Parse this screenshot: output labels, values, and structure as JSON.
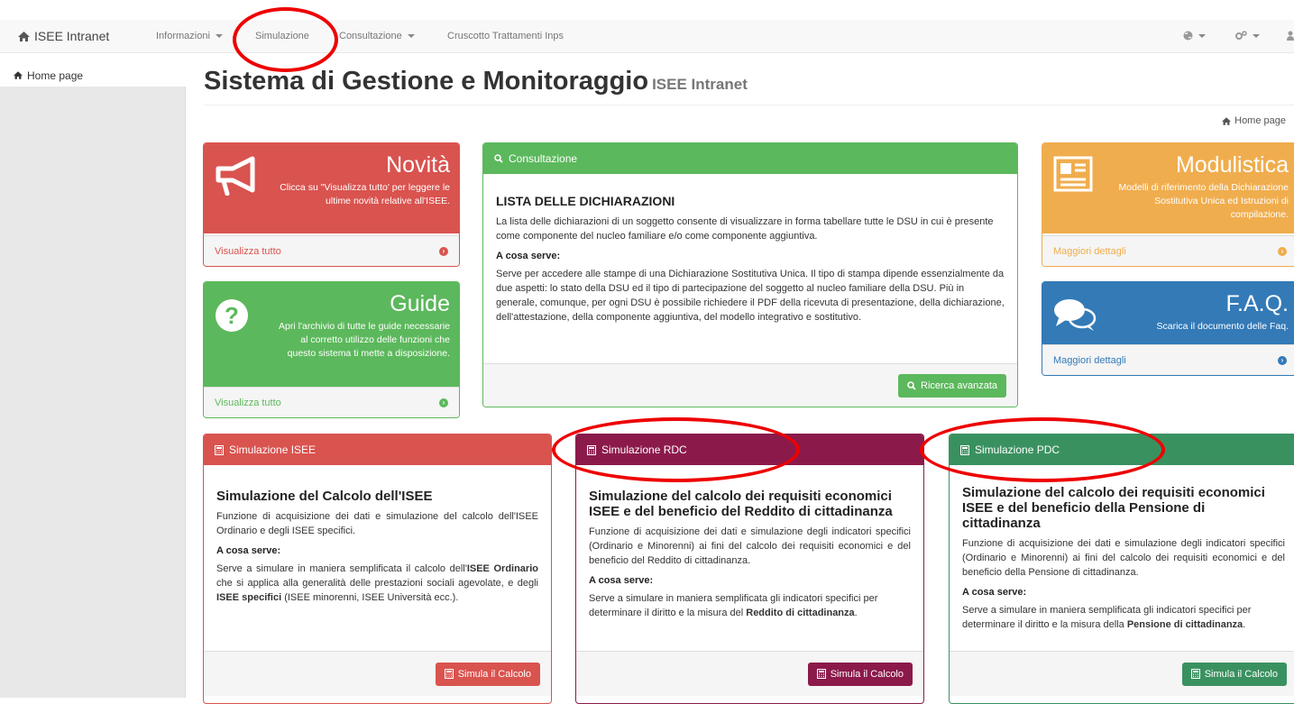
{
  "navbar": {
    "brand": "ISEE Intranet",
    "items": [
      {
        "label": "Informazioni",
        "has_caret": true
      },
      {
        "label": "Simulazione",
        "has_caret": false
      },
      {
        "label": "Consultazione",
        "has_caret": true
      },
      {
        "label": "Cruscotto Trattamenti Inps",
        "has_caret": false
      }
    ],
    "right_icons": [
      "globe-icon",
      "cogs-icon",
      "user-icon"
    ]
  },
  "sidebar": {
    "items": [
      {
        "label": "Home page",
        "icon": "home-icon"
      }
    ]
  },
  "header": {
    "title": "Sistema di Gestione e Monitoraggio",
    "subtitle": "ISEE Intranet"
  },
  "breadcrumb": {
    "label": "Home page"
  },
  "novita": {
    "title": "Novità",
    "description": "Clicca su \"Visualizza tutto' per leggere le ultime novità relative all'ISEE.",
    "footer": "Visualizza tutto",
    "color": "#d9534f"
  },
  "guide": {
    "title": "Guide",
    "description": "Apri l'archivio di tutte le guide necessarie al corretto utilizzo delle funzioni che questo sistema ti mette a disposizione.",
    "footer": "Visualizza tutto",
    "color": "#5cb85c"
  },
  "consultazione": {
    "heading": "Consultazione",
    "title": "LISTA DELLE DICHIARAZIONI",
    "intro": "La lista delle dichiarazioni di un soggetto consente di visualizzare in forma tabellare tutte le DSU in cui è presente come componente del nucleo familiare e/o come componente aggiuntiva.",
    "subtitle": "A cosa serve:",
    "body": "Serve per accedere alle stampe di una Dichiarazione Sostitutiva Unica. Il tipo di stampa dipende essenzialmente da due aspetti: lo stato della DSU ed il tipo di partecipazione del soggetto al nucleo familiare della DSU. Più in generale, comunque, per ogni DSU è possibile richiedere il PDF della ricevuta di presentazione, della dichiarazione, dell'attestazione, della componente aggiuntiva, del modello integrativo e sostitutivo.",
    "button": "Ricerca avanzata",
    "color": "#5cb85c"
  },
  "modulistica": {
    "title": "Modulistica",
    "description": "Modelli di riferimento della Dichiarazione Sostitutiva Unica ed Istruzioni di compilazione.",
    "footer": "Maggiori dettagli",
    "color": "#f0ad4e"
  },
  "faq": {
    "title": "F.A.Q.",
    "description": "Scarica il documento delle Faq.",
    "footer": "Maggiori dettagli",
    "color": "#337ab7"
  },
  "sim_isee": {
    "heading": "Simulazione ISEE",
    "title": "Simulazione del Calcolo dell'ISEE",
    "intro": "Funzione di acquisizione dei dati e simulazione del calcolo dell'ISEE Ordinario e degli ISEE specifici.",
    "subtitle": "A cosa serve:",
    "body_1": "Serve a simulare in maniera semplificata il calcolo dell'",
    "body_b1": "ISEE Ordinario",
    "body_2": " che si applica alla generalità delle prestazioni sociali agevolate, e degli ",
    "body_b2": "ISEE specifici",
    "body_3": " (ISEE minorenni, ISEE Università ecc.).",
    "button": "Simula il Calcolo",
    "color": "#d9534f"
  },
  "sim_rdc": {
    "heading": "Simulazione RDC",
    "title": "Simulazione del calcolo dei requisiti economici ISEE e del beneficio del Reddito di cittadinanza",
    "intro": "Funzione di acquisizione dei dati e simulazione degli indicatori specifici (Ordinario e Minorenni) ai fini del calcolo dei requisiti economici e del beneficio del Reddito di cittadinanza.",
    "subtitle": "A cosa serve:",
    "body_1": "Serve a simulare in maniera semplificata gli indicatori specifici per determinare il diritto e la misura del ",
    "body_b1": "Reddito di cittadinanza",
    "body_2": ".",
    "button": "Simula il Calcolo",
    "color": "#8b1a4a"
  },
  "sim_pdc": {
    "heading": "Simulazione PDC",
    "title": "Simulazione del calcolo dei requisiti economici ISEE e del beneficio della Pensione di cittadinanza",
    "intro": "Funzione di acquisizione dei dati e simulazione degli indicatori specifici (Ordinario e Minorenni) ai fini del calcolo dei requisiti economici e del beneficio della Pensione di cittadinanza.",
    "subtitle": "A cosa serve:",
    "body_1": "Serve a simulare in maniera semplificata gli indicatori specifici per determinare il diritto e la misura della ",
    "body_b1": "Pensione di cittadinanza",
    "body_2": ".",
    "button": "Simula il Calcolo",
    "color": "#3a9160"
  },
  "annotation_color": "#ee0000"
}
